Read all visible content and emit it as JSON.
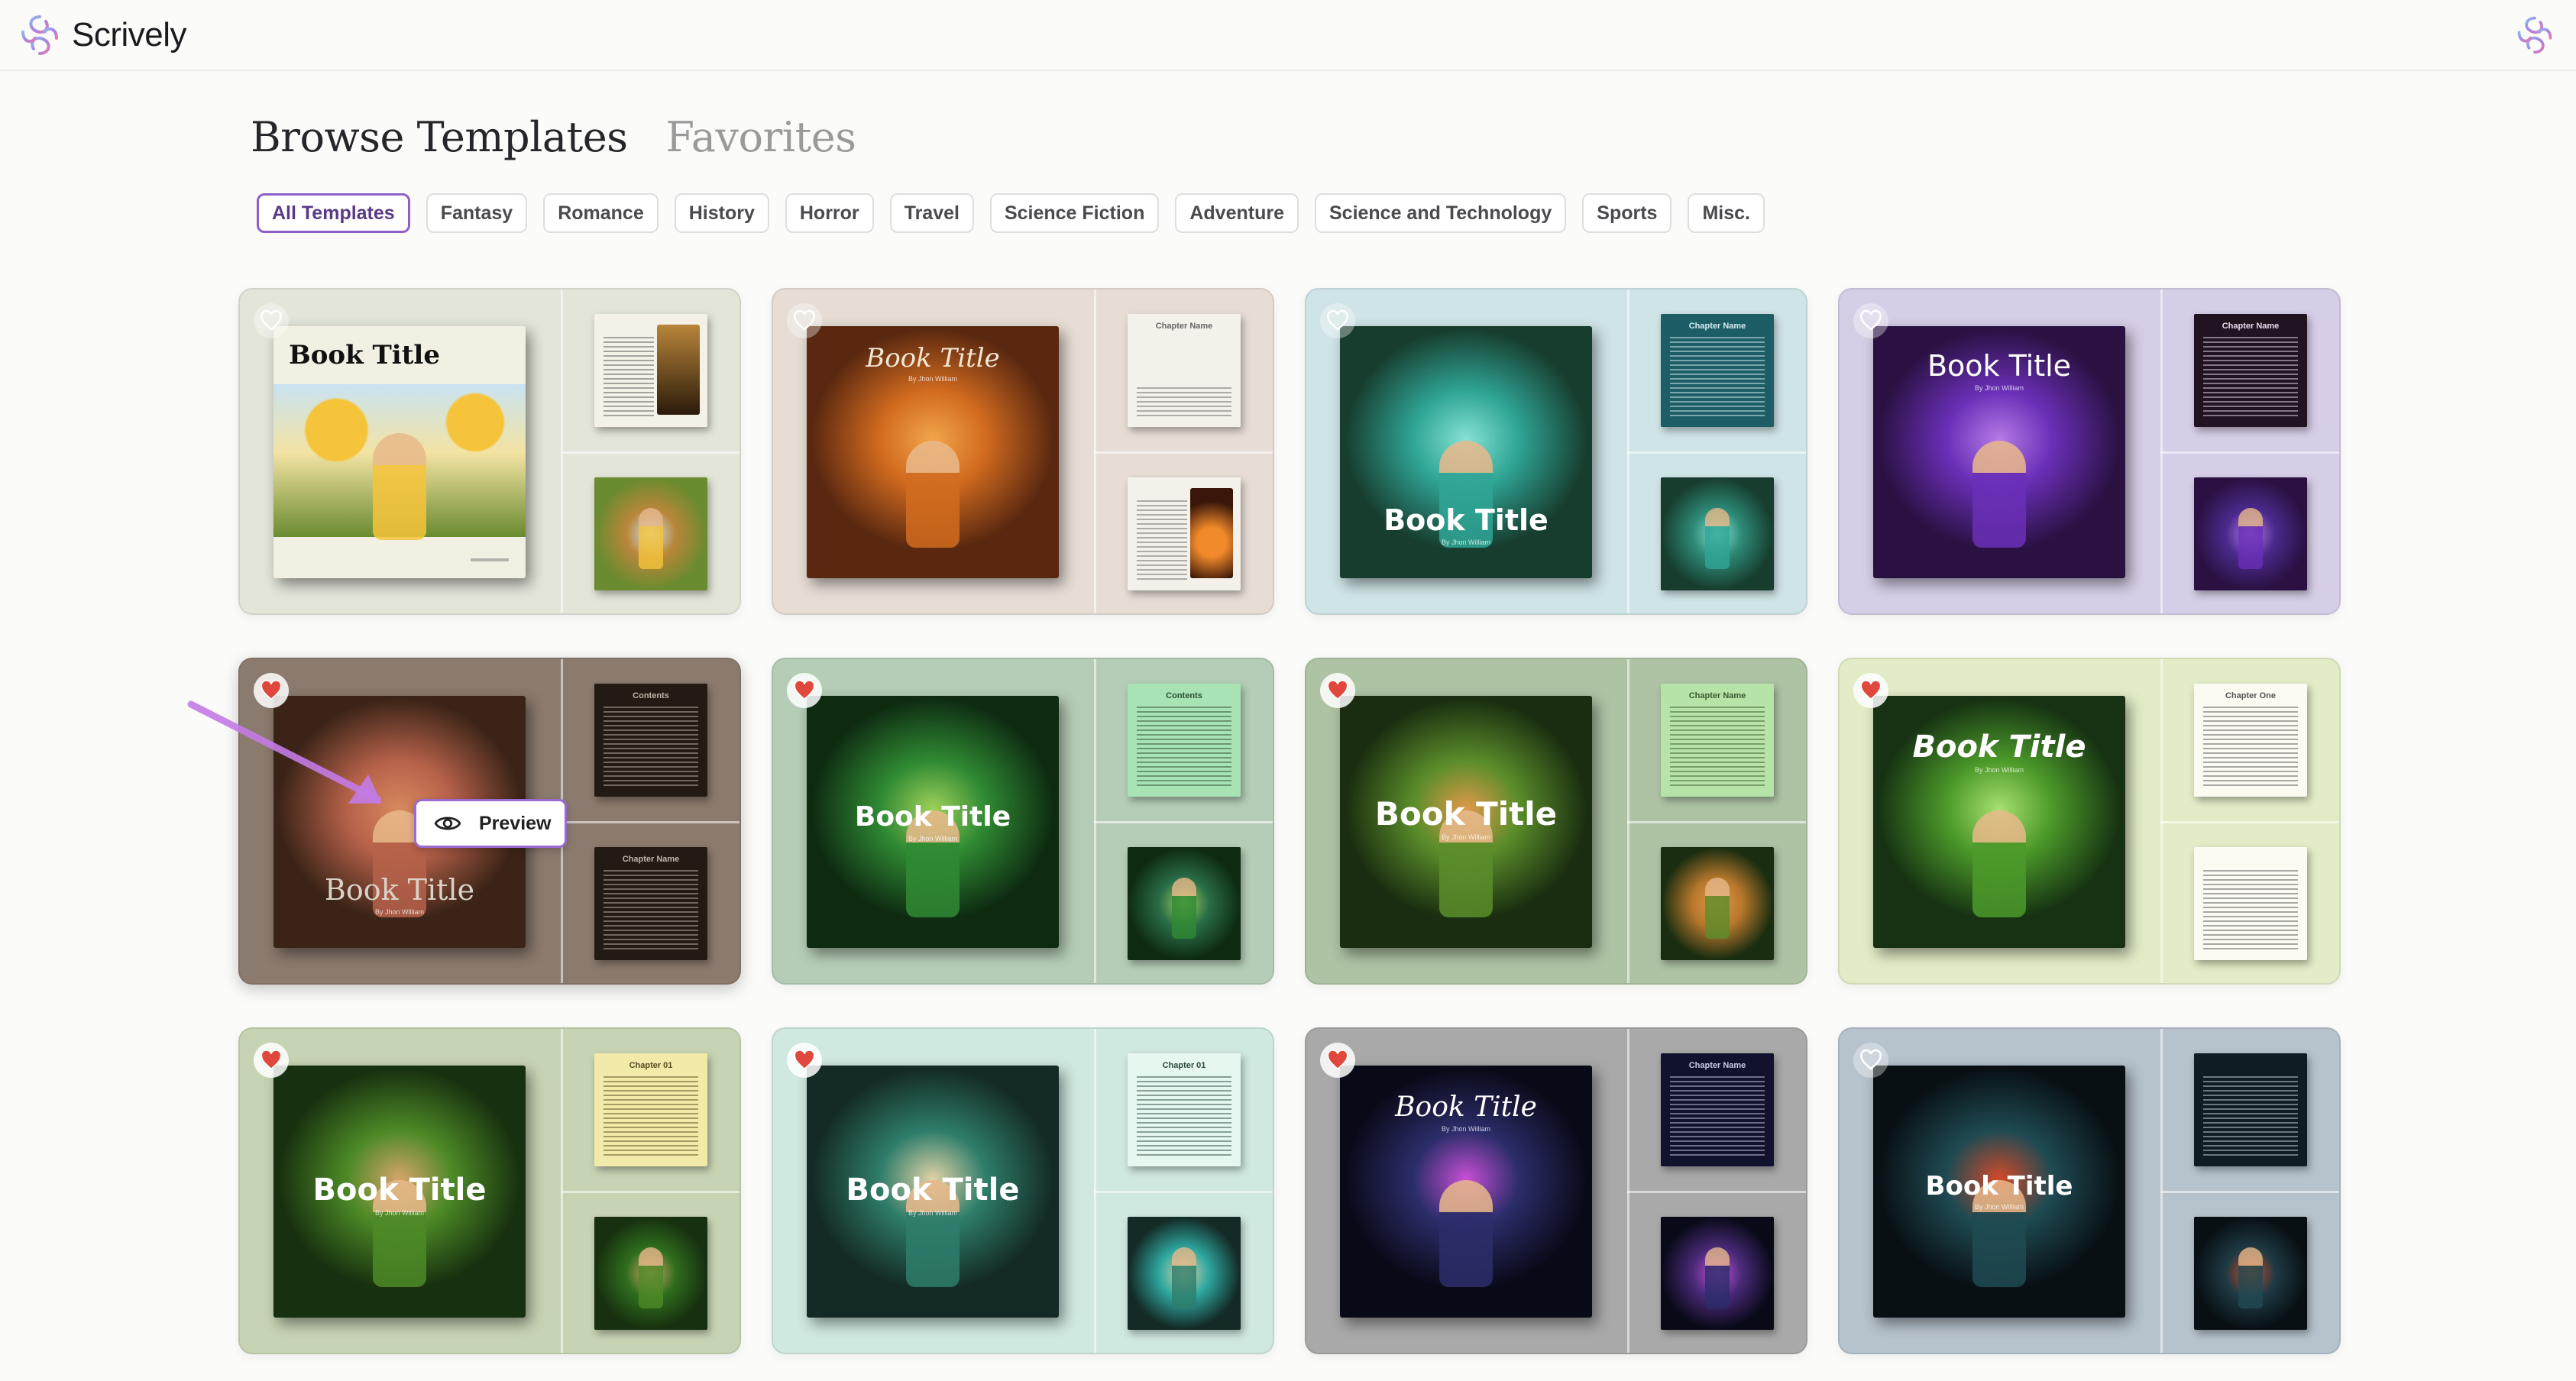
{
  "app": {
    "name": "Scrively"
  },
  "page_tabs": [
    {
      "label": "Browse Templates",
      "active": true
    },
    {
      "label": "Favorites",
      "active": false
    }
  ],
  "filters": [
    {
      "label": "All Templates",
      "active": true
    },
    {
      "label": "Fantasy"
    },
    {
      "label": "Romance"
    },
    {
      "label": "History"
    },
    {
      "label": "Horror"
    },
    {
      "label": "Travel"
    },
    {
      "label": "Science Fiction"
    },
    {
      "label": "Adventure"
    },
    {
      "label": "Science and Technology"
    },
    {
      "label": "Sports"
    },
    {
      "label": "Misc."
    }
  ],
  "preview_label": "Preview",
  "templates": [
    {
      "title": "Book Title",
      "favorited": false,
      "bg": "#e3e5d9",
      "cover_bg": "#f2f0e2",
      "art": [
        "#f6c43a",
        "#6a8b2f",
        "#c9e3f2"
      ],
      "title_color": "#111111",
      "page_bg": "#f4f1e6",
      "page_ink": "#555555",
      "thumb_art": "#b9863a"
    },
    {
      "title": "Book Title",
      "subtitle": "By Jhon William",
      "favorited": false,
      "bg": "#e7ddd5",
      "cover_bg": "#3a1d10",
      "art": [
        "#d26b1f",
        "#5a2810",
        "#f2a64a"
      ],
      "title_color": "#f2e7d4",
      "page_bg": "#f4f1ea",
      "page_ink": "#666666",
      "thumb_art": "#c9531c",
      "top_head": "Chapter Name"
    },
    {
      "title": "Book Title",
      "subtitle": "By Jhon William",
      "favorited": false,
      "bg": "#cfe4e6",
      "cover_bg": "#0f3a36",
      "art": [
        "#2fa596",
        "#173d2e",
        "#86e2d4"
      ],
      "title_color": "#ffffff",
      "page_bg": "#1d5d66",
      "page_ink": "#d6eff2",
      "thumb_art": "#2d8a77",
      "top_head": "Chapter Name"
    },
    {
      "title": "Book Title",
      "subtitle": "By Jhon William",
      "favorited": false,
      "bg": "#d6cde6",
      "cover_bg": "#1a0d2a",
      "art": [
        "#6a2fb8",
        "#2a1142",
        "#b57be6"
      ],
      "title_color": "#ffffff",
      "page_bg": "#21131f",
      "page_ink": "#e8dcef",
      "thumb_art": "#4a2a8c",
      "top_head": "Chapter Name"
    },
    {
      "title": "Book Title",
      "subtitle": "By Jhon William",
      "favorited": true,
      "active": true,
      "bg": "#8b7a6e",
      "cover_bg": "#2a1e16",
      "art": [
        "#b6614a",
        "#3b2417",
        "#d7895d"
      ],
      "title_color": "#d9d2c7",
      "page_bg": "#231a14",
      "page_ink": "#bfb4a6",
      "thumb_art": "#3a2a1e",
      "top_head": "Contents",
      "bot_head": "Chapter Name"
    },
    {
      "title": "Book Title",
      "subtitle": "By Jhon William",
      "favorited": true,
      "bg": "#b5cdb6",
      "cover_bg": "#123818",
      "art": [
        "#2f8a33",
        "#0e2b12",
        "#9fd15a"
      ],
      "title_color": "#ffffff",
      "page_bg": "#a8e3b4",
      "page_ink": "#2b4d33",
      "thumb_art": "#2a6e48",
      "top_head": "Contents"
    },
    {
      "title": "Book Title",
      "subtitle": "By Jhon William",
      "favorited": true,
      "bg": "#aec3a4",
      "cover_bg": "#1c3214",
      "art": [
        "#5a8d2a",
        "#1a2d10",
        "#e09a4a"
      ],
      "title_color": "#ffffff",
      "page_bg": "#b6e3a7",
      "page_ink": "#3a5a32",
      "thumb_art": "#b8782c",
      "top_head": "Chapter Name"
    },
    {
      "title": "Book Title",
      "subtitle": "By Jhon William",
      "favorited": true,
      "bg": "#e2ecc6",
      "cover_bg": "#1c3614",
      "art": [
        "#4c9a2a",
        "#163212",
        "#a8e070"
      ],
      "title_color": "#ffffff",
      "page_bg": "#fbfbf2",
      "page_ink": "#555555",
      "thumb_art": "#7cc24a",
      "top_head": "Chapter One"
    },
    {
      "title": "Book Title",
      "subtitle": "By Jhon William",
      "favorited": true,
      "bg": "#c7d4b4",
      "cover_bg": "#1e3d16",
      "art": [
        "#4d8a26",
        "#17300f",
        "#d5a46a"
      ],
      "title_color": "#ffffff",
      "page_bg": "#f2eaa8",
      "page_ink": "#5a4a20",
      "thumb_art": "#2f6e1e",
      "top_head": "Chapter 01"
    },
    {
      "title": "Book Title",
      "subtitle": "By Jhon William",
      "favorited": true,
      "bg": "#cfe8e0",
      "cover_bg": "#1b3a34",
      "art": [
        "#2e7d6a",
        "#142a26",
        "#e0d2a6"
      ],
      "title_color": "#ffffff",
      "page_bg": "#e6f7f0",
      "page_ink": "#2b4a3f",
      "thumb_art": "#2ea8a0",
      "top_head": "Chapter 01"
    },
    {
      "title": "Book Title",
      "subtitle": "By Jhon William",
      "favorited": true,
      "bg": "#a9a9a9",
      "cover_bg": "#0d0f24",
      "art": [
        "#2b2d6a",
        "#090a18",
        "#c74fd6"
      ],
      "title_color": "#ffffff",
      "page_bg": "#11132e",
      "page_ink": "#c8c8e0",
      "thumb_art": "#4a2a7a",
      "top_head": "Chapter Name"
    },
    {
      "title": "Book Title",
      "subtitle": "By Jhon William",
      "favorited": false,
      "bg": "#b6c2cc",
      "cover_bg": "#0c1a22",
      "art": [
        "#1f4a52",
        "#081014",
        "#d14a2a"
      ],
      "title_color": "#ffffff",
      "page_bg": "#0f1c24",
      "page_ink": "#c8d4d8",
      "thumb_art": "#1f3a44"
    }
  ]
}
